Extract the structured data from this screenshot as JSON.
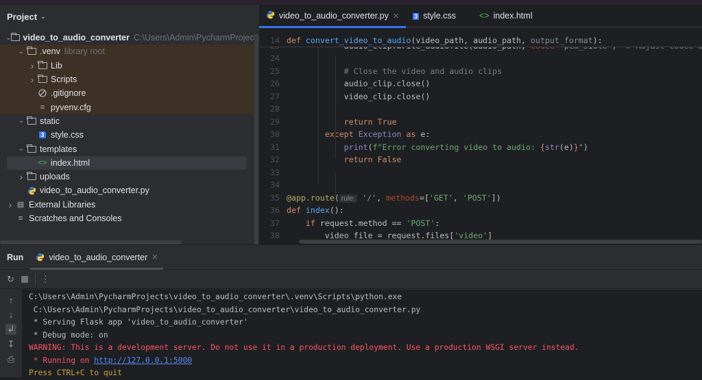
{
  "project_panel": {
    "title": "Project",
    "tree": [
      {
        "label": "video_to_audio_converter",
        "hint": "C:\\Users\\Admin\\PycharmProjects\\vid",
        "level": 0,
        "type": "folder",
        "expanded": true,
        "bold": true
      },
      {
        "label": ".venv",
        "hint": "library root",
        "level": 1,
        "type": "folder",
        "expanded": true,
        "venv": true
      },
      {
        "label": "Lib",
        "level": 2,
        "type": "folder",
        "expanded": false,
        "venv": true
      },
      {
        "label": "Scripts",
        "level": 2,
        "type": "folder",
        "expanded": false,
        "venv": true
      },
      {
        "label": ".gitignore",
        "level": 2,
        "type": "ignore",
        "venv": true
      },
      {
        "label": "pyvenv.cfg",
        "level": 2,
        "type": "text",
        "venv": true
      },
      {
        "label": "static",
        "level": 1,
        "type": "folder",
        "expanded": true
      },
      {
        "label": "style.css",
        "level": 2,
        "type": "css"
      },
      {
        "label": "templates",
        "level": 1,
        "type": "folder",
        "expanded": true
      },
      {
        "label": "index.html",
        "level": 2,
        "type": "html",
        "selected": true
      },
      {
        "label": "uploads",
        "level": 1,
        "type": "folder",
        "expanded": false
      },
      {
        "label": "video_to_audio_converter.py",
        "level": 1,
        "type": "python"
      },
      {
        "label": "External Libraries",
        "level": 0,
        "type": "library",
        "expanded": false
      },
      {
        "label": "Scratches and Consoles",
        "level": 0,
        "type": "scratches"
      }
    ]
  },
  "editor": {
    "tabs": [
      {
        "label": "video_to_audio_converter.py",
        "icon": "python-icon",
        "active": true,
        "closable": true
      },
      {
        "label": "style.css",
        "icon": "css-icon"
      },
      {
        "label": "index.html",
        "icon": "html-icon"
      }
    ],
    "sticky": {
      "n": "14",
      "tokens": [
        [
          "def ",
          "kw"
        ],
        [
          "convert_video_to_audio",
          "fn"
        ],
        [
          "(video_path, audio_path, ",
          "p"
        ],
        [
          "output_format",
          "gp"
        ],
        [
          "):",
          "p"
        ]
      ]
    },
    "lines": [
      {
        "n": "23",
        "tokens": [
          [
            "            audio_clip.write_audiofile(audio_path, ",
            "p"
          ],
          [
            "codec=",
            "kwa"
          ],
          [
            "'pcm_s16le'",
            "str"
          ],
          [
            ")  ",
            "p"
          ],
          [
            "# Adjust codec as ne",
            "cm"
          ]
        ]
      },
      {
        "n": "24",
        "tokens": []
      },
      {
        "n": "25",
        "tokens": [
          [
            "            ",
            "p"
          ],
          [
            "# Close the video and audio clips",
            "cm"
          ]
        ]
      },
      {
        "n": "26",
        "tokens": [
          [
            "            audio_clip.close()",
            "p"
          ]
        ]
      },
      {
        "n": "27",
        "tokens": [
          [
            "            video_clip.close()",
            "p"
          ]
        ]
      },
      {
        "n": "28",
        "tokens": []
      },
      {
        "n": "29",
        "tokens": [
          [
            "            ",
            "p"
          ],
          [
            "return True",
            "kw"
          ]
        ]
      },
      {
        "n": "30",
        "tokens": [
          [
            "        ",
            "p"
          ],
          [
            "except ",
            "kw"
          ],
          [
            "Exception",
            "bi"
          ],
          [
            " as ",
            "kw"
          ],
          [
            "e:",
            "p"
          ]
        ]
      },
      {
        "n": "31",
        "tokens": [
          [
            "            ",
            "p"
          ],
          [
            "print",
            "bi"
          ],
          [
            "(",
            "p"
          ],
          [
            "f\"Error converting video to audio: ",
            "str"
          ],
          [
            "{",
            "kw"
          ],
          [
            "str",
            "bi"
          ],
          [
            "(e)",
            "p"
          ],
          [
            "}",
            "kw"
          ],
          [
            "\"",
            "str"
          ],
          [
            ")",
            "p"
          ]
        ]
      },
      {
        "n": "32",
        "tokens": [
          [
            "            ",
            "p"
          ],
          [
            "return False",
            "kw"
          ]
        ]
      },
      {
        "n": "33",
        "tokens": []
      },
      {
        "n": "34",
        "tokens": []
      },
      {
        "n": "35",
        "tokens": [
          [
            "@app.route",
            "dec"
          ],
          [
            "(",
            "p"
          ],
          [
            "rule:",
            "inlay"
          ],
          [
            " '/'",
            "str"
          ],
          [
            ", ",
            "p"
          ],
          [
            "methods",
            "kwa"
          ],
          [
            "=[",
            "p"
          ],
          [
            "'GET'",
            "str"
          ],
          [
            ", ",
            "p"
          ],
          [
            "'POST'",
            "str"
          ],
          [
            "])",
            "p"
          ]
        ]
      },
      {
        "n": "36",
        "tokens": [
          [
            "def ",
            "kw"
          ],
          [
            "index",
            "fn"
          ],
          [
            "():",
            "p"
          ]
        ]
      },
      {
        "n": "37",
        "tokens": [
          [
            "    ",
            "p"
          ],
          [
            "if ",
            "kw"
          ],
          [
            "request.method == ",
            "p"
          ],
          [
            "'POST'",
            "str"
          ],
          [
            ":",
            "p"
          ]
        ]
      },
      {
        "n": "38",
        "tokens": [
          [
            "        video_file = request.files[",
            "p"
          ],
          [
            "'video'",
            "str"
          ],
          [
            "]",
            "p"
          ]
        ]
      },
      {
        "n": "39",
        "tokens": []
      }
    ]
  },
  "run": {
    "label": "Run",
    "tab": "video_to_audio_converter",
    "output": [
      {
        "text": "C:\\Users\\Admin\\PycharmProjects\\video_to_audio_converter\\.venv\\Scripts\\python.exe",
        "style": "normal"
      },
      {
        "text": " C:\\Users\\Admin\\PycharmProjects\\video_to_audio_converter\\video_to_audio_converter.py",
        "style": "normal"
      },
      {
        "text": " * Serving Flask app 'video_to_audio_converter'",
        "style": "normal"
      },
      {
        "text": " * Debug mode: on",
        "style": "normal"
      },
      {
        "text": "WARNING: This is a development server. Do not use it in a production deployment. Use a production WSGI server instead.",
        "style": "red"
      },
      {
        "text": " * Running on ",
        "style": "red",
        "link": "http://127.0.0.1:5000"
      },
      {
        "text": "Press CTRL+C to quit",
        "style": "yel"
      }
    ]
  },
  "colors": {
    "accent": "#3574f0",
    "venv_bg": "#3d3024",
    "warning": "#f75464",
    "link": "#548af7"
  }
}
